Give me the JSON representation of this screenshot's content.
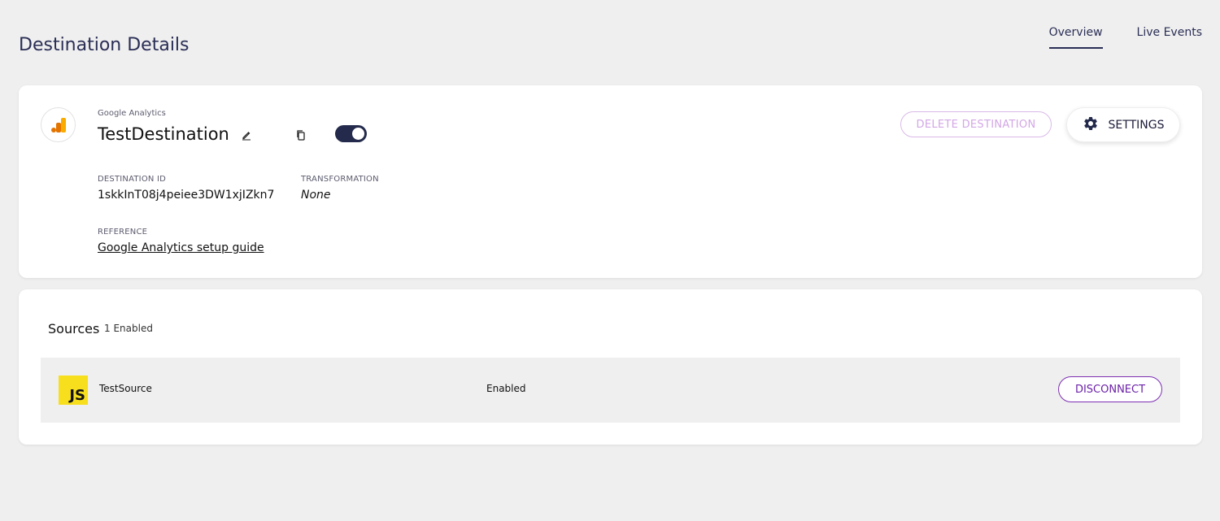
{
  "header": {
    "title": "Destination Details",
    "tabs": [
      {
        "label": "Overview",
        "active": true
      },
      {
        "label": "Live Events",
        "active": false
      }
    ]
  },
  "destination": {
    "provider": "Google Analytics",
    "name": "TestDestination",
    "enabled": true,
    "delete_label": "DELETE DESTINATION",
    "settings_label": "SETTINGS",
    "destination_id_label": "DESTINATION ID",
    "destination_id": "1skkInT08j4peiee3DW1xjIZkn7",
    "transformation_label": "TRANSFORMATION",
    "transformation": "None",
    "reference_label": "REFERENCE",
    "reference_link": "Google Analytics setup guide",
    "icons": [
      "google-analytics-logo",
      "edit-icon",
      "copy-icon",
      "gear-icon"
    ]
  },
  "sources": {
    "title": "Sources",
    "count_text": "1 Enabled",
    "items": [
      {
        "name": "TestSource",
        "status": "Enabled",
        "action": "DISCONNECT",
        "icon": "javascript-logo"
      }
    ]
  },
  "colors": {
    "background": "#efefef",
    "navy": "#232a4b",
    "accent_purple": "#6b21a8",
    "delete_disabled": "#d3a7e6",
    "js_yellow": "#f7df1e",
    "ga_orange": "#f9ab00",
    "ga_dark_orange": "#e37400"
  }
}
